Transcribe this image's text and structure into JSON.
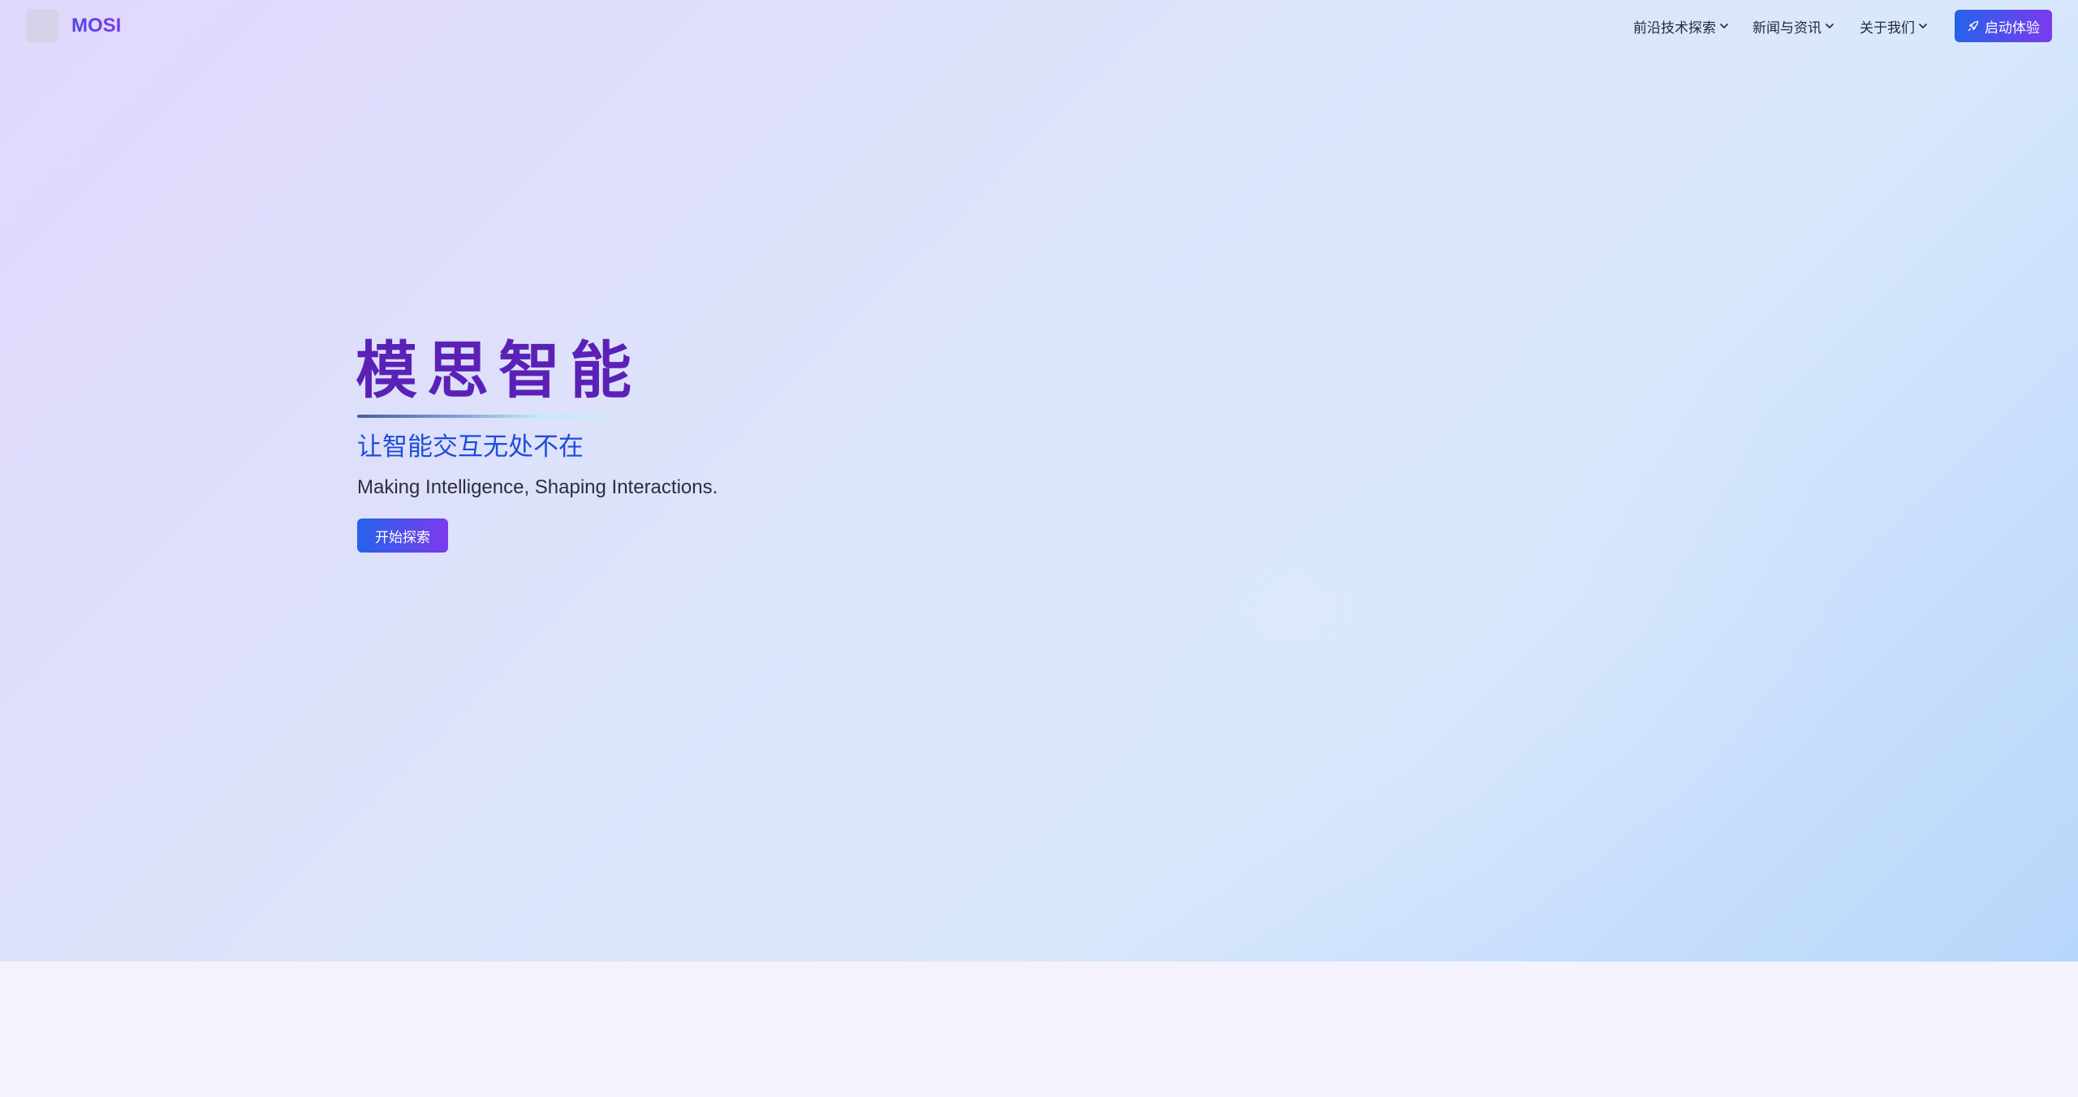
{
  "header": {
    "brand": "MOSI",
    "nav": [
      {
        "label": "前沿技术探索",
        "icon": "chevron-down-icon"
      },
      {
        "label": "新闻与资讯",
        "icon": "chevron-down-icon"
      },
      {
        "label": "关于我们",
        "icon": "chevron-down-icon"
      }
    ],
    "cta": {
      "label": "启动体验",
      "icon": "rocket-icon"
    }
  },
  "hero": {
    "title": "模思智能",
    "subtitle": "让智能交互无处不在",
    "tagline": "Making Intelligence, Shaping Interactions.",
    "button": "开始探索"
  },
  "colors": {
    "accent_start": "#2563eb",
    "accent_end": "#7c3aed",
    "title": "#5b21b6",
    "subtitle": "#1d4ed8"
  }
}
